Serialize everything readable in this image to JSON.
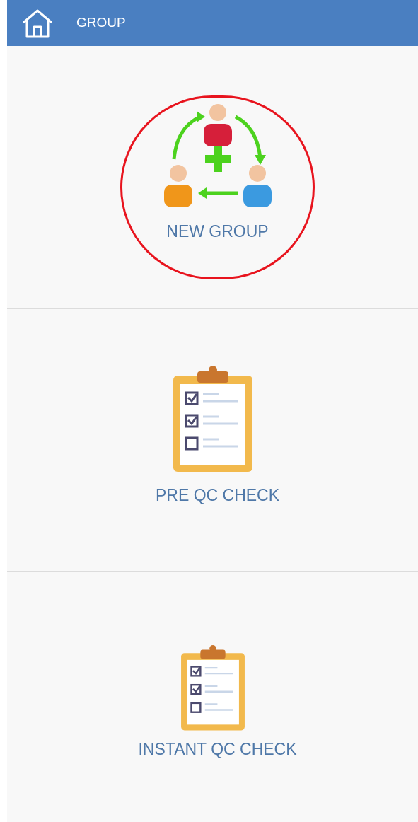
{
  "header": {
    "title": "GROUP"
  },
  "items": [
    {
      "kind": "group",
      "label": "NEW GROUP",
      "highlighted": true
    },
    {
      "kind": "clipboard-large",
      "label": "PRE QC CHECK",
      "highlighted": false
    },
    {
      "kind": "clipboard-small",
      "label": "INSTANT QC CHECK",
      "highlighted": false
    }
  ]
}
